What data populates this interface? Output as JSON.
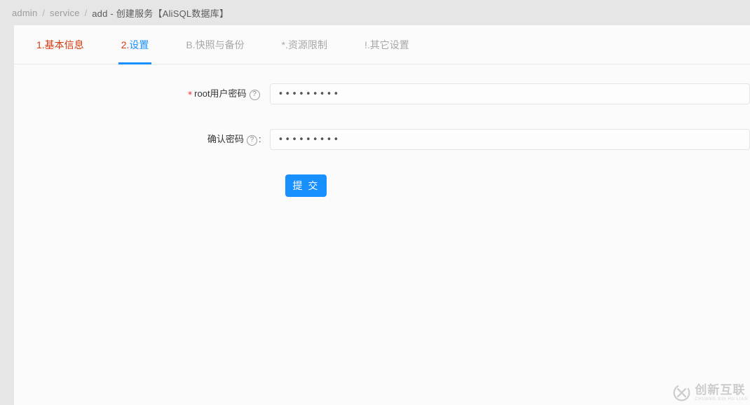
{
  "breadcrumb": {
    "items": [
      "admin",
      "service"
    ],
    "separator": "/",
    "current": "add - 创建服务【AliSQL数据库】"
  },
  "tabs": [
    {
      "label": "1.基本信息",
      "num": "1.",
      "name": "基本信息",
      "active": false
    },
    {
      "num": "2.",
      "name": "设置",
      "label": "2.设置",
      "active": true
    },
    {
      "label": "B.快照与备份",
      "num": "B.",
      "name": "快照与备份",
      "active": false
    },
    {
      "label": "*.资源限制",
      "num": "*.",
      "name": "资源限制",
      "active": false
    },
    {
      "label": "!.其它设置",
      "num": "!.",
      "name": "其它设置",
      "active": false
    }
  ],
  "form": {
    "fields": [
      {
        "required_mark": "*",
        "label": "root用户密码",
        "help_icon": "?",
        "suffix": "",
        "value": "•••••••••",
        "placeholder": ""
      },
      {
        "required_mark": "",
        "label": "确认密码",
        "help_icon": "?",
        "suffix": ":",
        "value": "•••••••••",
        "placeholder": ""
      }
    ],
    "submit_label": "提 交"
  },
  "watermark": {
    "mark": "CX",
    "title": "创新互联",
    "subtitle": "CHUANG XIN HU LIAN"
  },
  "colors": {
    "accent_blue": "#1890ff",
    "required_red": "#f5222d",
    "tab_red": "#d4380d",
    "page_bg": "#e6e6e6",
    "panel_bg": "#fbfbfb"
  }
}
